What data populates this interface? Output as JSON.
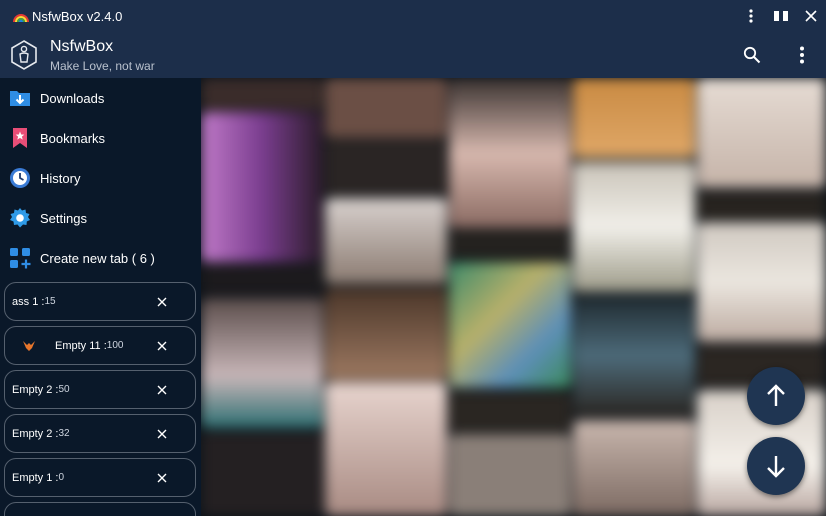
{
  "window": {
    "title": "NsfwBox v2.4.0"
  },
  "appbar": {
    "name": "NsfwBox",
    "subtitle": "Make Love, not war",
    "icons": [
      "search-icon",
      "more-vert-icon"
    ]
  },
  "nav": [
    {
      "label": "Downloads",
      "icon": "download-folder-icon",
      "color": "#2f8de4"
    },
    {
      "label": "Bookmarks",
      "icon": "bookmark-icon",
      "color": "#e94e77"
    },
    {
      "label": "History",
      "icon": "clock-icon",
      "color": "#3a7bd5"
    },
    {
      "label": "Settings",
      "icon": "gear-icon",
      "color": "#2f9be8"
    },
    {
      "label": "Create new tab ( 6 )",
      "icon": "add-tab-icon",
      "color": "#2f8de4"
    }
  ],
  "tabs": [
    {
      "name": "ass",
      "num": "1",
      "count": "15"
    },
    {
      "name": "Empty",
      "num": "11",
      "count": "100"
    },
    {
      "name": "Empty",
      "num": "2",
      "count": "50"
    },
    {
      "name": "Empty",
      "num": "2",
      "count": "32"
    },
    {
      "name": "Empty",
      "num": "1",
      "count": "0"
    }
  ],
  "colors": {
    "titlebar": "#1c2e4a",
    "sidebar": "#0a1829",
    "fab": "#1f3552"
  },
  "fabs": [
    "arrow-up-icon",
    "arrow-down-icon"
  ]
}
